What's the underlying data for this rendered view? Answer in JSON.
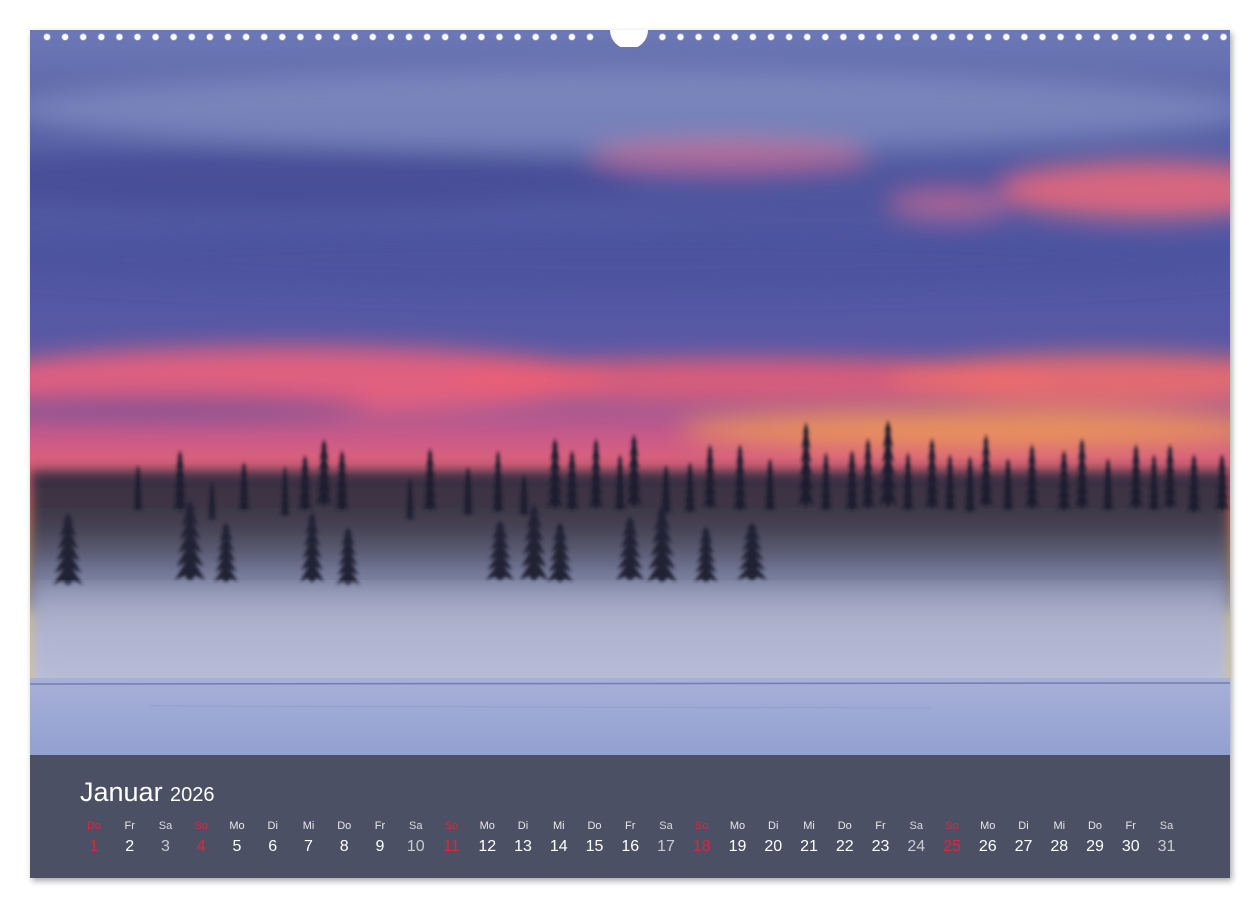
{
  "calendar": {
    "month": "Januar",
    "year": "2026",
    "days": [
      {
        "dow": "Do",
        "num": "1",
        "type": "holiday"
      },
      {
        "dow": "Fr",
        "num": "2",
        "type": "weekday"
      },
      {
        "dow": "Sa",
        "num": "3",
        "type": "sat"
      },
      {
        "dow": "So",
        "num": "4",
        "type": "sun"
      },
      {
        "dow": "Mo",
        "num": "5",
        "type": "weekday"
      },
      {
        "dow": "Di",
        "num": "6",
        "type": "weekday"
      },
      {
        "dow": "Mi",
        "num": "7",
        "type": "weekday"
      },
      {
        "dow": "Do",
        "num": "8",
        "type": "weekday"
      },
      {
        "dow": "Fr",
        "num": "9",
        "type": "weekday"
      },
      {
        "dow": "Sa",
        "num": "10",
        "type": "sat"
      },
      {
        "dow": "So",
        "num": "11",
        "type": "sun"
      },
      {
        "dow": "Mo",
        "num": "12",
        "type": "weekday"
      },
      {
        "dow": "Di",
        "num": "13",
        "type": "weekday"
      },
      {
        "dow": "Mi",
        "num": "14",
        "type": "weekday"
      },
      {
        "dow": "Do",
        "num": "15",
        "type": "weekday"
      },
      {
        "dow": "Fr",
        "num": "16",
        "type": "weekday"
      },
      {
        "dow": "Sa",
        "num": "17",
        "type": "sat"
      },
      {
        "dow": "So",
        "num": "18",
        "type": "sun"
      },
      {
        "dow": "Mo",
        "num": "19",
        "type": "weekday"
      },
      {
        "dow": "Di",
        "num": "20",
        "type": "weekday"
      },
      {
        "dow": "Mi",
        "num": "21",
        "type": "weekday"
      },
      {
        "dow": "Do",
        "num": "22",
        "type": "weekday"
      },
      {
        "dow": "Fr",
        "num": "23",
        "type": "weekday"
      },
      {
        "dow": "Sa",
        "num": "24",
        "type": "sat"
      },
      {
        "dow": "So",
        "num": "25",
        "type": "sun"
      },
      {
        "dow": "Mo",
        "num": "26",
        "type": "weekday"
      },
      {
        "dow": "Di",
        "num": "27",
        "type": "weekday"
      },
      {
        "dow": "Mi",
        "num": "28",
        "type": "weekday"
      },
      {
        "dow": "Do",
        "num": "29",
        "type": "weekday"
      },
      {
        "dow": "Fr",
        "num": "30",
        "type": "weekday"
      },
      {
        "dow": "Sa",
        "num": "31",
        "type": "sat"
      }
    ]
  },
  "photo": {
    "subject": "foggy-winter-forest-sunset",
    "colors": {
      "sky_top": "#5a5fa0",
      "sky_pink": "#ee5f7a",
      "sky_orange": "#f6a23a",
      "horizon_yellow": "#f3c842",
      "fog": "#aab0d0",
      "snow": "#9aa6d2",
      "trees": "#1c2030"
    }
  },
  "theme": {
    "strip_bg": "#4b5064",
    "sunday_red": "#e0263a",
    "text": "#ffffff"
  }
}
